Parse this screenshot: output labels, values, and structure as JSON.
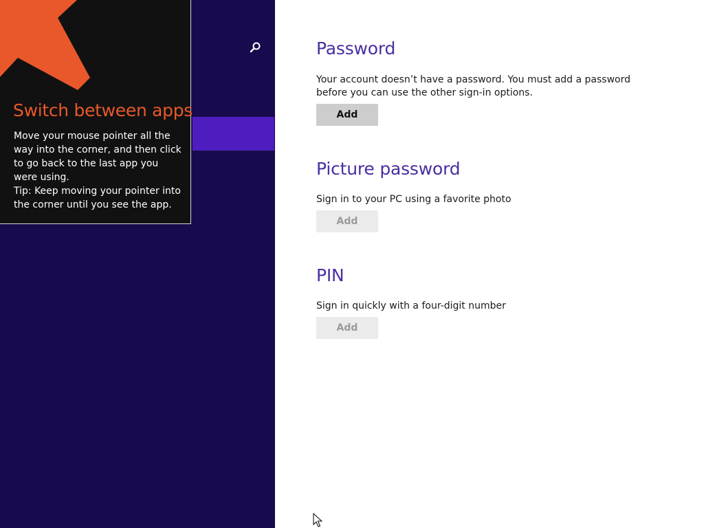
{
  "colors": {
    "nav_background": "#180a4c",
    "nav_selected": "#4f1dbf",
    "heading": "#4b2ea0",
    "tip_title": "#e8582a",
    "tip_background": "#111111",
    "arrow": "#e8582a"
  },
  "nav": {
    "search_icon": "search-icon"
  },
  "tip": {
    "title": "Switch between apps",
    "body": "Move your mouse pointer all the way into the corner, and then click to go back to the last app you were using.",
    "tip_line": "Tip: Keep moving your pointer into the corner until you see the app.",
    "arrow_icon": "arrow-up-left-icon"
  },
  "sections": [
    {
      "title": "Password",
      "description": "Your account doesn’t have a password. You must add a password before you can use the other sign-in options.",
      "button_label": "Add",
      "button_enabled": true
    },
    {
      "title": "Picture password",
      "description": "Sign in to your PC using a favorite photo",
      "button_label": "Add",
      "button_enabled": false
    },
    {
      "title": "PIN",
      "description": "Sign in quickly with a four-digit number",
      "button_label": "Add",
      "button_enabled": false
    }
  ]
}
